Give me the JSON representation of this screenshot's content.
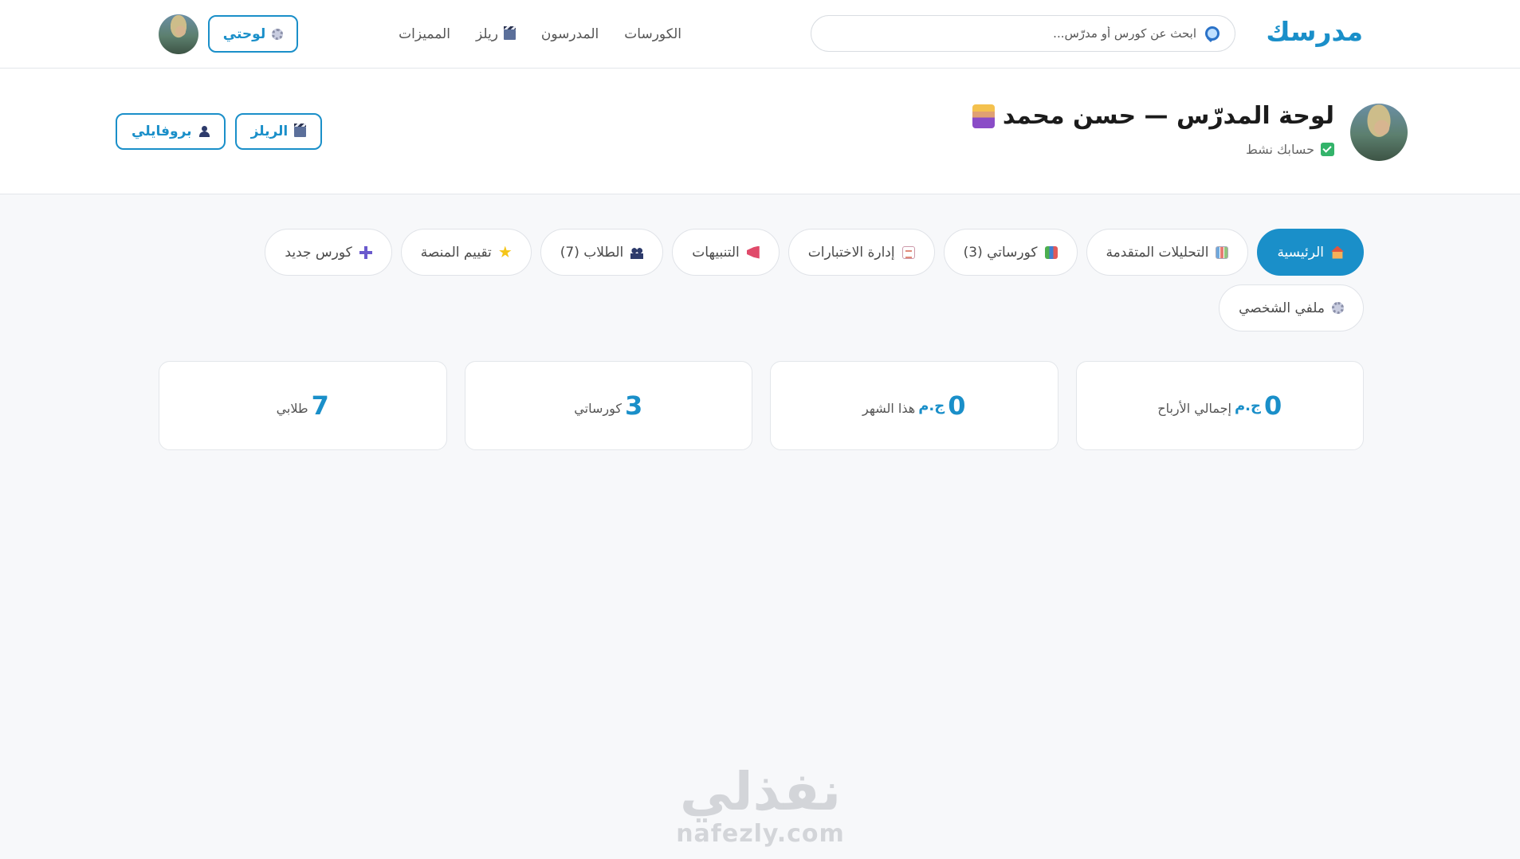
{
  "navbar": {
    "logo": "مدرسك",
    "search_placeholder": "ابحث عن كورس أو مدرّس...",
    "links": [
      {
        "label": "الكورسات"
      },
      {
        "label": "المدرسون"
      },
      {
        "label": "ريلز"
      },
      {
        "label": "المميزات"
      }
    ],
    "dashboard_button": "لوحتي"
  },
  "header": {
    "title": "لوحة المدرّس — حسن محمد",
    "status": "حسابك نشط",
    "profile_button": "بروفايلي",
    "reels_button": "الريلز"
  },
  "tabs": [
    {
      "label": "الرئيسية",
      "icon": "home-icon",
      "active": true
    },
    {
      "label": "التحليلات المتقدمة",
      "icon": "chart-icon"
    },
    {
      "label": "كورساتي (3)",
      "icon": "books-icon"
    },
    {
      "label": "إدارة الاختبارات",
      "icon": "document-icon"
    },
    {
      "label": "التنبيهات",
      "icon": "megaphone-icon"
    },
    {
      "label": "الطلاب (7)",
      "icon": "users-icon"
    },
    {
      "label": "تقييم المنصة",
      "icon": "star-icon"
    },
    {
      "label": "كورس جديد",
      "icon": "plus-icon"
    },
    {
      "label": "ملفي الشخصي",
      "icon": "gear-icon"
    }
  ],
  "stats": [
    {
      "value": "0",
      "currency": "ج.م",
      "label": "إجمالي الأرباح"
    },
    {
      "value": "0",
      "currency": "ج.م",
      "label": "هذا الشهر"
    },
    {
      "value": "3",
      "currency": "",
      "label": "كورساتي"
    },
    {
      "value": "7",
      "currency": "",
      "label": "طلابي"
    }
  ],
  "watermark": {
    "arabic": "نفذلي",
    "latin": "nafezly.com"
  },
  "colors": {
    "accent": "#1a8fc9",
    "background": "#f7f8fa",
    "card": "#ffffff"
  }
}
